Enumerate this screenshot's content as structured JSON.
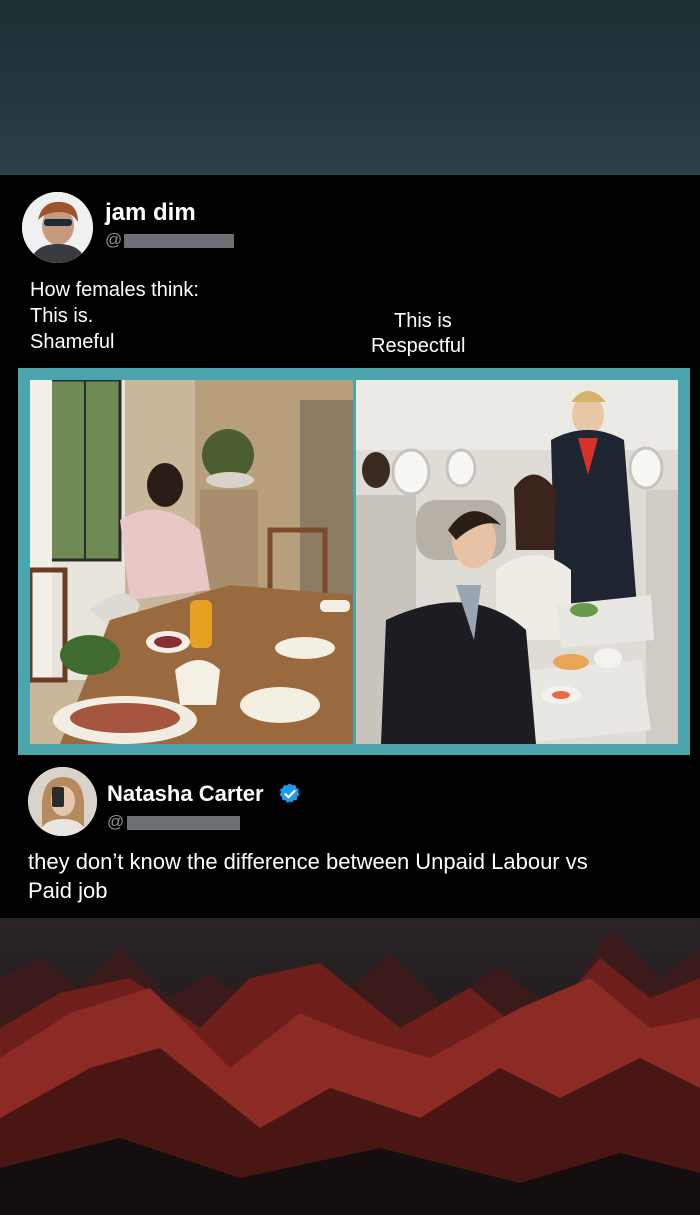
{
  "post": {
    "author_name": "jam dim",
    "handle_prefix": "@",
    "lines": [
      "How females think:",
      "This is.",
      "Shameful"
    ],
    "right_caption": [
      "This is",
      "Respectful"
    ]
  },
  "reply": {
    "author_name": "Natasha Carter",
    "handle_prefix": "@",
    "verified": true,
    "lines": [
      "they don’t know the difference between Unpaid Labour vs",
      "Paid job"
    ]
  },
  "images": {
    "left": "photo-woman-setting-dining-table",
    "right": "photo-airline-business-class-meal-service"
  },
  "colors": {
    "card_bg": "#000000",
    "frame": "#4aa5ad",
    "verified_blue": "#1d9bf0"
  }
}
